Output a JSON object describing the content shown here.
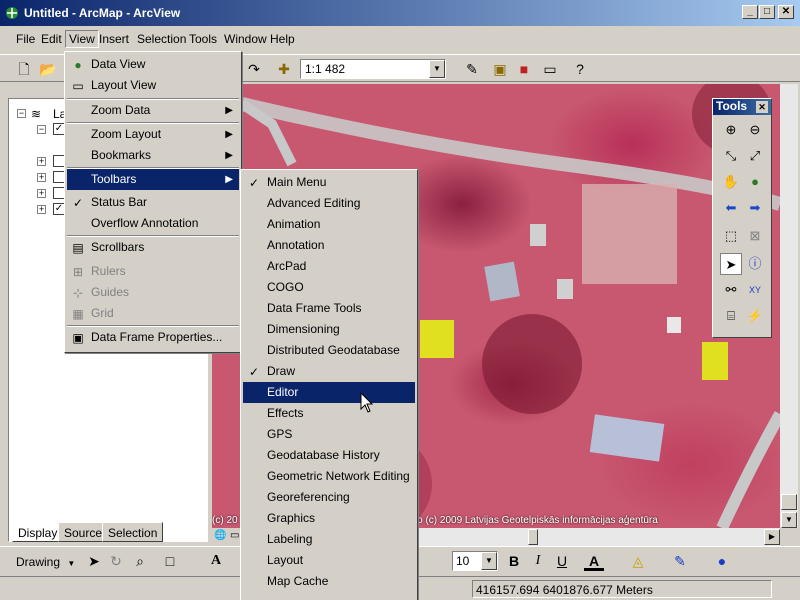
{
  "window": {
    "title": "Untitled - ArcMap - ArcView",
    "controls": [
      "_",
      "□",
      "✕"
    ]
  },
  "menubar": {
    "items": [
      "File",
      "Edit",
      "View",
      "Insert",
      "Selection",
      "Tools",
      "Window",
      "Help"
    ]
  },
  "standard_toolbar": {
    "scale": "1:1 482"
  },
  "toc": {
    "layer_label": "La",
    "tabs": [
      "Display",
      "Source",
      "Selection"
    ]
  },
  "map": {
    "copyright": "(c) 2009 ... foto (c) 2009 Latvijas Geotelpiskās informācijas aģentūra",
    "copyright_left": "(c) 20",
    "copyright_right": "foto (c) 2009 Latvijas Geotelpiskās informācijas aģentūra"
  },
  "tools_palette": {
    "title": "Tools"
  },
  "view_menu": {
    "items": [
      {
        "label": "Data View",
        "icon": "globe-icon"
      },
      {
        "label": "Layout View",
        "icon": "layout-icon"
      },
      {
        "label": "Zoom Data",
        "submenu": true
      },
      {
        "label": "Zoom Layout",
        "submenu": true
      },
      {
        "label": "Bookmarks",
        "submenu": true
      },
      {
        "label": "Toolbars",
        "submenu": true,
        "highlighted": true
      },
      {
        "label": "Status Bar",
        "checked": true
      },
      {
        "label": "Overflow Annotation"
      },
      {
        "label": "Scrollbars",
        "icon": "scrollbars-icon"
      },
      {
        "label": "Rulers",
        "disabled": true
      },
      {
        "label": "Guides",
        "disabled": true
      },
      {
        "label": "Grid",
        "disabled": true
      },
      {
        "label": "Data Frame Properties...",
        "icon": "properties-icon"
      }
    ]
  },
  "toolbars_submenu": {
    "items": [
      {
        "label": "Main Menu",
        "checked": true
      },
      {
        "label": "Advanced Editing"
      },
      {
        "label": "Animation"
      },
      {
        "label": "Annotation"
      },
      {
        "label": "ArcPad"
      },
      {
        "label": "COGO"
      },
      {
        "label": "Data Frame Tools"
      },
      {
        "label": "Dimensioning"
      },
      {
        "label": "Distributed Geodatabase"
      },
      {
        "label": "Draw",
        "checked": true
      },
      {
        "label": "Editor",
        "highlighted": true
      },
      {
        "label": "Effects"
      },
      {
        "label": "GPS"
      },
      {
        "label": "Geodatabase History"
      },
      {
        "label": "Geometric Network Editing"
      },
      {
        "label": "Georeferencing"
      },
      {
        "label": "Graphics"
      },
      {
        "label": "Labeling"
      },
      {
        "label": "Layout"
      },
      {
        "label": "Map Cache"
      }
    ]
  },
  "drawing_toolbar": {
    "label": "Drawing",
    "font_size": "10",
    "bold": "B",
    "italic": "I",
    "underline": "U",
    "text_a": "A"
  },
  "status_bar": {
    "coordinates": "416157.694  6401876.677 Meters"
  },
  "colors": {
    "title_bar": "#0a246a",
    "menu_highlight": "#0a246a",
    "face": "#d4d0c8",
    "map_infrared": "#c85870"
  }
}
